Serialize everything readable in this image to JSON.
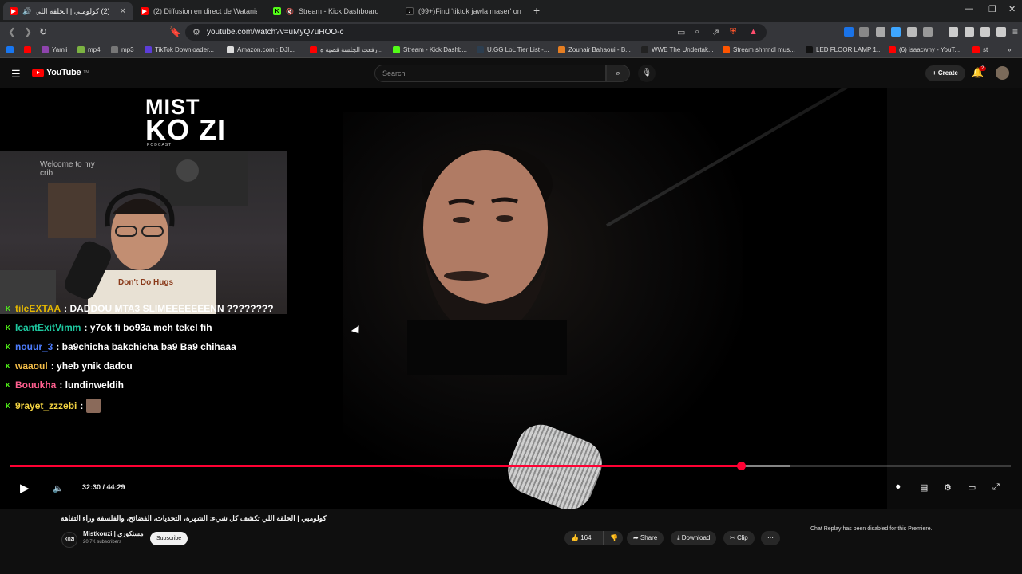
{
  "browser": {
    "tabs": [
      {
        "label": "(2) كولومبي | الحلقة اللي تكشف",
        "active": true,
        "fav_color": "#ff0000"
      },
      {
        "label": "(2) Diffusion en direct de Watania2 R",
        "active": false,
        "fav_color": "#ff0000"
      },
      {
        "label": "Stream - Kick Dashboard",
        "active": false,
        "fav_color": "#53fc18"
      },
      {
        "label": "(99+)Find 'tiktok jawla maser' on TikT",
        "active": false,
        "fav_color": "#111111"
      }
    ],
    "url": "youtube.com/watch?v=uMyQ7uHOO-c",
    "bookmarks": [
      {
        "label": "",
        "color": "#1877f2"
      },
      {
        "label": "",
        "color": "#ff0000"
      },
      {
        "label": "Yamli",
        "color": "#8e44ad"
      },
      {
        "label": "mp4",
        "color": "#7cb342"
      },
      {
        "label": "mp3",
        "color": "#777777"
      },
      {
        "label": "TikTok Downloader...",
        "color": "#5c3dd8"
      },
      {
        "label": "Amazon.com : DJI...",
        "color": "#dddddd"
      },
      {
        "label": "رفعت الجلسة قضية ه...",
        "color": "#ff0000"
      },
      {
        "label": "Stream - Kick Dashb...",
        "color": "#53fc18"
      },
      {
        "label": "U.GG LoL Tier List -...",
        "color": "#2c3e50"
      },
      {
        "label": "Zouhair Bahaoui - B...",
        "color": "#e67e22"
      },
      {
        "label": "WWE The Undertak...",
        "color": "#222222"
      },
      {
        "label": "Stream shmndl mus...",
        "color": "#ff5500"
      },
      {
        "label": "LED FLOOR LAMP 1...",
        "color": "#111111"
      },
      {
        "label": "(6) isaacwhy - YouT...",
        "color": "#ff0000"
      },
      {
        "label": "st",
        "color": "#ff0000"
      }
    ]
  },
  "youtube": {
    "logo_text": "YouTube",
    "logo_region": "TN",
    "search_placeholder": "Search",
    "create_label": "Create",
    "notif_count": "2"
  },
  "video": {
    "show_logo_top": "MIST",
    "show_logo_bottom": "KO ZI",
    "show_logo_sub": "PODCAST",
    "webcam_sign": "Welcome to my crib",
    "webcam_shirt": "Don't Do Hugs",
    "chat": [
      {
        "user": "tileEXTAA",
        "message": ": DADDOU MTA3 SLIMEEEEEEENN ????????",
        "user_color": "#e5b800",
        "badge": "⬜"
      },
      {
        "user": "IcantExitVimm",
        "message": ": y7ok fi bo93a mch tekel fih",
        "user_color": "#1ec9a0",
        "badge": "▲"
      },
      {
        "user": "nouur_3",
        "message": ": ba9chicha bakchicha ba9 Ba9 chihaaa",
        "user_color": "#4d7dff",
        "badge": "K"
      },
      {
        "user": "waaoul",
        "message": ": yheb ynik dadou",
        "user_color": "#f7c04a",
        "badge": "⬜"
      },
      {
        "user": "Bouukha",
        "message": ": lundinweldih",
        "user_color": "#ff5f8f",
        "badge": "K"
      },
      {
        "user": "9rayet_zzzebi",
        "message": ":",
        "user_color": "#f4d442",
        "badge": "K"
      }
    ],
    "current_time": "32:30",
    "duration": "44:29",
    "time_display": "32:30 / 44:29",
    "played_fraction": 0.73,
    "buffered_fraction": 0.78,
    "title": "كولومبي | الحلقة اللي تكشف كل شيء: الشهرة، التحديات، الفضائح، والفلسفة وراء التفاهة",
    "channel": "Mistkouzi | مستكوزي",
    "subscribers": "20.7K subscribers",
    "subscribe_label": "Subscribe",
    "likes": "164",
    "share_label": "Share",
    "download_label": "Download",
    "clip_label": "Clip",
    "chat_disabled": "Chat Replay has been disabled for this Premiere."
  }
}
